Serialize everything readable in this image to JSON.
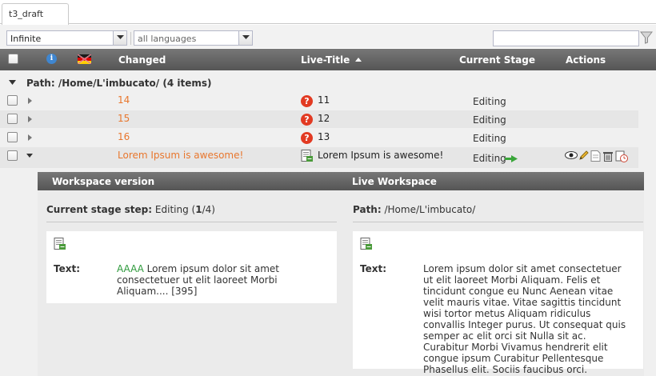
{
  "tabs": {
    "active_label": "t3_draft"
  },
  "toolbar": {
    "depth_select": "Infinite",
    "language_select": "all languages",
    "search_value": ""
  },
  "columns": {
    "changed": "Changed",
    "live_title": "Live-Title",
    "current_stage": "Current Stage",
    "actions": "Actions"
  },
  "group": {
    "label": "Path: /Home/L'imbucato/ (4 items)"
  },
  "rows": [
    {
      "changed": "14",
      "live_title": "11",
      "stage": "Editing"
    },
    {
      "changed": "15",
      "live_title": "12",
      "stage": "Editing"
    },
    {
      "changed": "16",
      "live_title": "13",
      "stage": "Editing"
    },
    {
      "changed": "Lorem Ipsum is awesome!",
      "live_title": "Lorem Ipsum is awesome!",
      "stage": "Editing"
    }
  ],
  "detail": {
    "workspace_header": "Workspace version",
    "live_header": "Live Workspace",
    "stage_label": "Current stage step:",
    "stage_value": "Editing",
    "stage_step": "1",
    "stage_total": "4",
    "path_label": "Path:",
    "path_value": "/Home/L'imbucato/",
    "text_label": "Text:",
    "workspace_text_added": "AAAA",
    "workspace_text": "Lorem ipsum dolor sit amet consectetuer ut elit laoreet Morbi Aliquam.... [395]",
    "live_text": "Lorem ipsum dolor sit amet consectetuer ut elit laoreet Morbi Aliquam. Felis et tincidunt congue eu Nunc Aenean vitae velit mauris vitae. Vitae sagittis tincidunt wisi tortor metus Aliquam ridiculus convallis Integer purus. Ut consequat quis semper ac elit orci sit Nulla sit ac. Curabitur Morbi Vivamus hendrerit elit congue ipsum Curabitur Pellentesque Phasellus elit. Sociis faucibus orci."
  },
  "colors": {
    "changed_link": "#e8772e",
    "header_bg": "#666666",
    "diff_added": "#2e9a3c",
    "question_icon": "#e23a22"
  }
}
